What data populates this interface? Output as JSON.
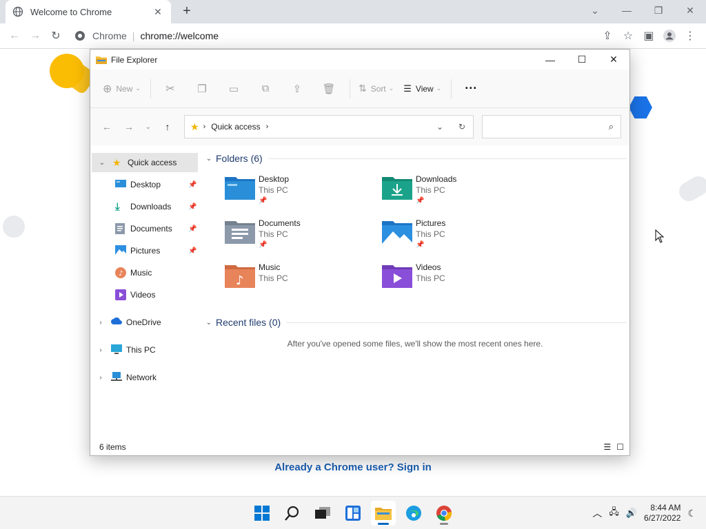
{
  "chrome": {
    "tab_title": "Welcome to Chrome",
    "site_label": "Chrome",
    "url": "chrome://welcome",
    "signin_link": "Already a Chrome user? Sign in"
  },
  "explorer": {
    "title": "File Explorer",
    "ribbon": {
      "new": "New",
      "sort": "Sort",
      "view": "View"
    },
    "address_crumb": "Quick access",
    "nav_pane": {
      "quick_access": "Quick access",
      "items": [
        "Desktop",
        "Downloads",
        "Documents",
        "Pictures",
        "Music",
        "Videos"
      ],
      "onedrive": "OneDrive",
      "this_pc": "This PC",
      "network": "Network"
    },
    "folders_header": "Folders (6)",
    "folders": [
      {
        "name": "Desktop",
        "location": "This PC",
        "icon": "desktop-folder-icon",
        "color": "#2a8fd8"
      },
      {
        "name": "Downloads",
        "location": "This PC",
        "icon": "downloads-folder-icon",
        "color": "#1aa38a"
      },
      {
        "name": "Documents",
        "location": "This PC",
        "icon": "documents-folder-icon",
        "color": "#8c99ab"
      },
      {
        "name": "Pictures",
        "location": "This PC",
        "icon": "pictures-folder-icon",
        "color": "#2d8fe0"
      },
      {
        "name": "Music",
        "location": "This PC",
        "icon": "music-folder-icon",
        "color": "#e8845a"
      },
      {
        "name": "Videos",
        "location": "This PC",
        "icon": "videos-folder-icon",
        "color": "#8a4fd8"
      }
    ],
    "recent_header": "Recent files (0)",
    "recent_empty": "After you've opened some files, we'll show the most recent ones here.",
    "status_items": "6 items"
  },
  "taskbar": {
    "time": "8:44 AM",
    "date": "6/27/2022"
  },
  "colors": {
    "accent": "#0067c0",
    "chrome_link": "#1a5fb4",
    "group_header": "#1e3a6e"
  }
}
